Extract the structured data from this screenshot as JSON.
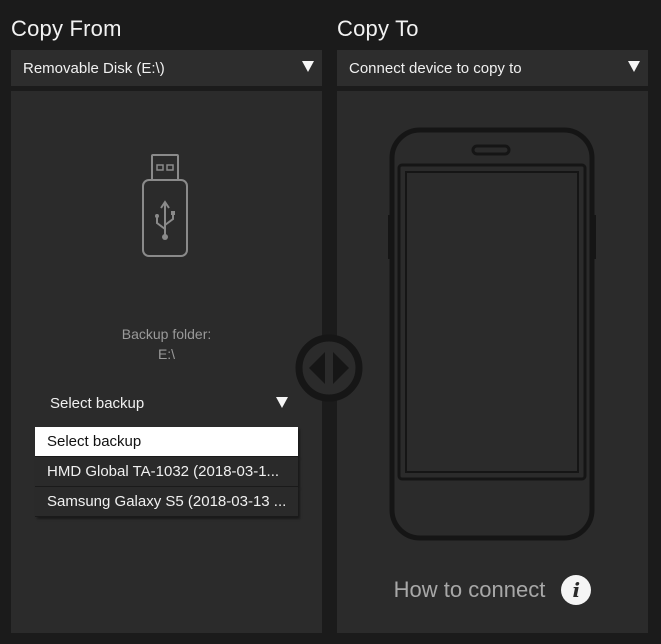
{
  "copy_from": {
    "title": "Copy From",
    "dropdown_value": "Removable Disk (E:\\)",
    "backup_folder_label": "Backup folder:",
    "backup_folder_path": "E:\\",
    "select_backup_label": "Select backup",
    "backup_options": [
      "Select backup",
      "HMD Global TA-1032 (2018-03-1...",
      "Samsung Galaxy S5 (2018-03-13 ..."
    ],
    "selected_index": 0
  },
  "copy_to": {
    "title": "Copy To",
    "dropdown_value": "Connect device to copy to",
    "how_to_connect": "How to connect",
    "info_icon_glyph": "i"
  },
  "icons": {
    "source": "usb-drive-icon",
    "target": "phone-icon",
    "swap": "swap-arrows-icon",
    "info": "info-icon"
  },
  "colors": {
    "background": "#1b1b1b",
    "panel": "#2b2b2b",
    "dropdown": "#2d2d2d",
    "icon_stroke": "#8a8a8a",
    "selected_item": "#ffffff"
  }
}
